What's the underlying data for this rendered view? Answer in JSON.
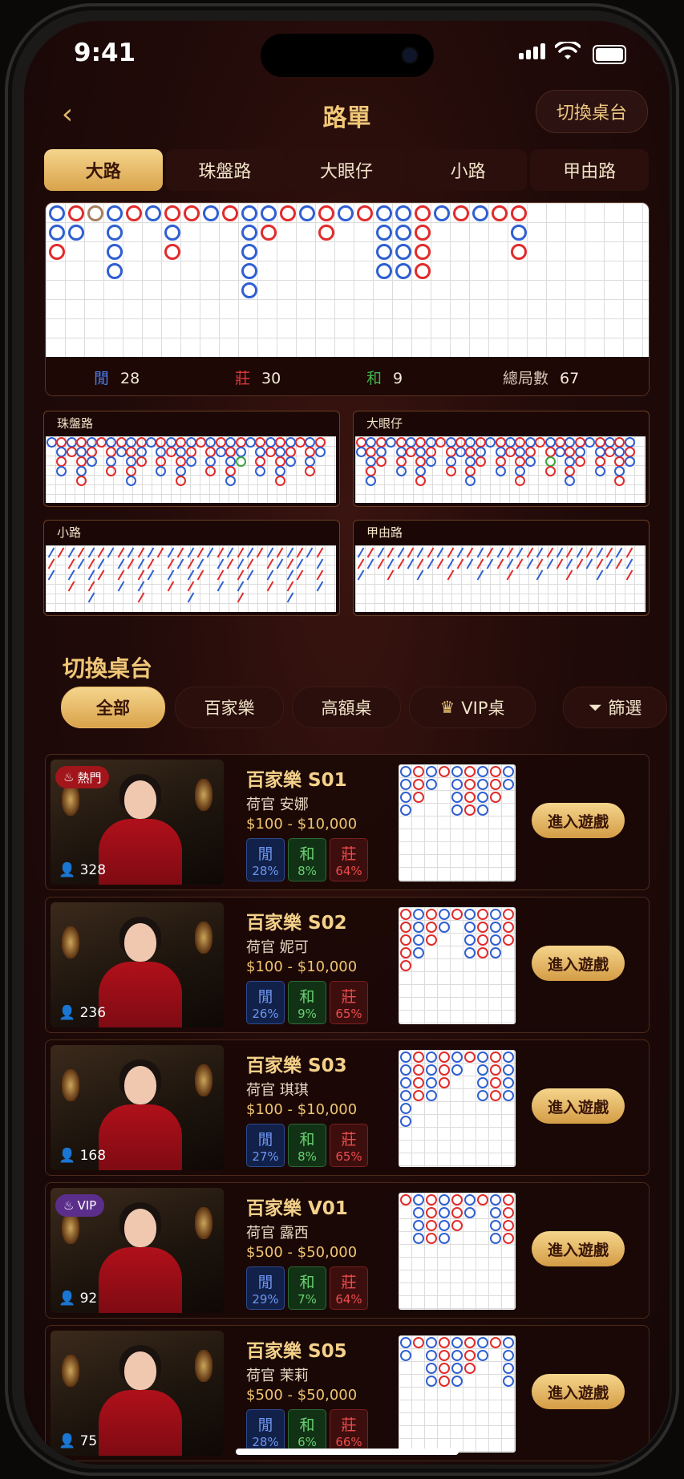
{
  "status": {
    "time": "9:41"
  },
  "header": {
    "title": "路單",
    "switch_label": "切換桌台"
  },
  "tabs": [
    {
      "label": "大路",
      "active": true
    },
    {
      "label": "珠盤路"
    },
    {
      "label": "大眼仔"
    },
    {
      "label": "小路"
    },
    {
      "label": "甲由路"
    }
  ],
  "stats": {
    "player_label": "閒",
    "player_count": "28",
    "banker_label": "莊",
    "banker_count": "30",
    "tie_label": "和",
    "tie_count": "9",
    "total_label": "總局數",
    "total_count": "67"
  },
  "mini_roads": [
    {
      "label": "珠盤路"
    },
    {
      "label": "大眼仔"
    },
    {
      "label": "小路"
    },
    {
      "label": "甲由路"
    }
  ],
  "section": {
    "title": "切換桌台"
  },
  "filters": {
    "all": "全部",
    "baccarat": "百家樂",
    "high": "高額桌",
    "vip": "VIP桌",
    "filter": "篩選"
  },
  "tables": [
    {
      "name": "百家樂 S01",
      "dealer_prefix": "荷官",
      "dealer": "安娜",
      "limit": "$100 - $10,000",
      "badge": "熱門",
      "badge_type": "hot",
      "viewers": "328",
      "player_pct": "28%",
      "tie_pct": "8%",
      "banker_pct": "64%",
      "enter": "進入遊戲",
      "player_label": "閒",
      "tie_label": "和",
      "banker_label": "莊"
    },
    {
      "name": "百家樂 S02",
      "dealer_prefix": "荷官",
      "dealer": "妮可",
      "limit": "$100 - $10,000",
      "badge": "",
      "badge_type": "",
      "viewers": "236",
      "player_pct": "26%",
      "tie_pct": "9%",
      "banker_pct": "65%",
      "enter": "進入遊戲",
      "player_label": "閒",
      "tie_label": "和",
      "banker_label": "莊"
    },
    {
      "name": "百家樂 S03",
      "dealer_prefix": "荷官",
      "dealer": "琪琪",
      "limit": "$100 - $10,000",
      "badge": "",
      "badge_type": "",
      "viewers": "168",
      "player_pct": "27%",
      "tie_pct": "8%",
      "banker_pct": "65%",
      "enter": "進入遊戲",
      "player_label": "閒",
      "tie_label": "和",
      "banker_label": "莊"
    },
    {
      "name": "百家樂 V01",
      "dealer_prefix": "荷官",
      "dealer": "露西",
      "limit": "$500 - $50,000",
      "badge": "VIP",
      "badge_type": "vip",
      "viewers": "92",
      "player_pct": "29%",
      "tie_pct": "7%",
      "banker_pct": "64%",
      "enter": "進入遊戲",
      "player_label": "閒",
      "tie_label": "和",
      "banker_label": "莊"
    },
    {
      "name": "百家樂 S05",
      "dealer_prefix": "荷官",
      "dealer": "茉莉",
      "limit": "$500 - $50,000",
      "badge": "",
      "badge_type": "",
      "viewers": "75",
      "player_pct": "28%",
      "tie_pct": "6%",
      "banker_pct": "66%",
      "enter": "進入遊戲",
      "player_label": "閒",
      "tie_label": "和",
      "banker_label": "莊"
    }
  ],
  "colors": {
    "gold": "#f0c777",
    "player": "#2f5fd1",
    "banker": "#e12b2b",
    "tie": "#3aa53f"
  },
  "big_road_columns": [
    [
      "b",
      "b",
      "r"
    ],
    [
      "r",
      "b"
    ],
    [
      "o"
    ],
    [
      "b",
      "b",
      "b",
      "b"
    ],
    [
      "r"
    ],
    [
      "b"
    ],
    [
      "r",
      "b",
      "r"
    ],
    [
      "r"
    ],
    [
      "b"
    ],
    [
      "r"
    ],
    [
      "b",
      "b",
      "b",
      "b",
      "b"
    ],
    [
      "b",
      "r"
    ],
    [
      "r"
    ],
    [
      "b"
    ],
    [
      "r",
      "r"
    ],
    [
      "b"
    ],
    [
      "r"
    ],
    [
      "b",
      "b",
      "b",
      "b"
    ],
    [
      "b",
      "b",
      "b",
      "b"
    ],
    [
      "r",
      "r",
      "r",
      "r"
    ],
    [
      "b"
    ],
    [
      "r"
    ],
    [
      "b"
    ],
    [
      "r"
    ],
    [
      "r",
      "b",
      "r"
    ]
  ]
}
